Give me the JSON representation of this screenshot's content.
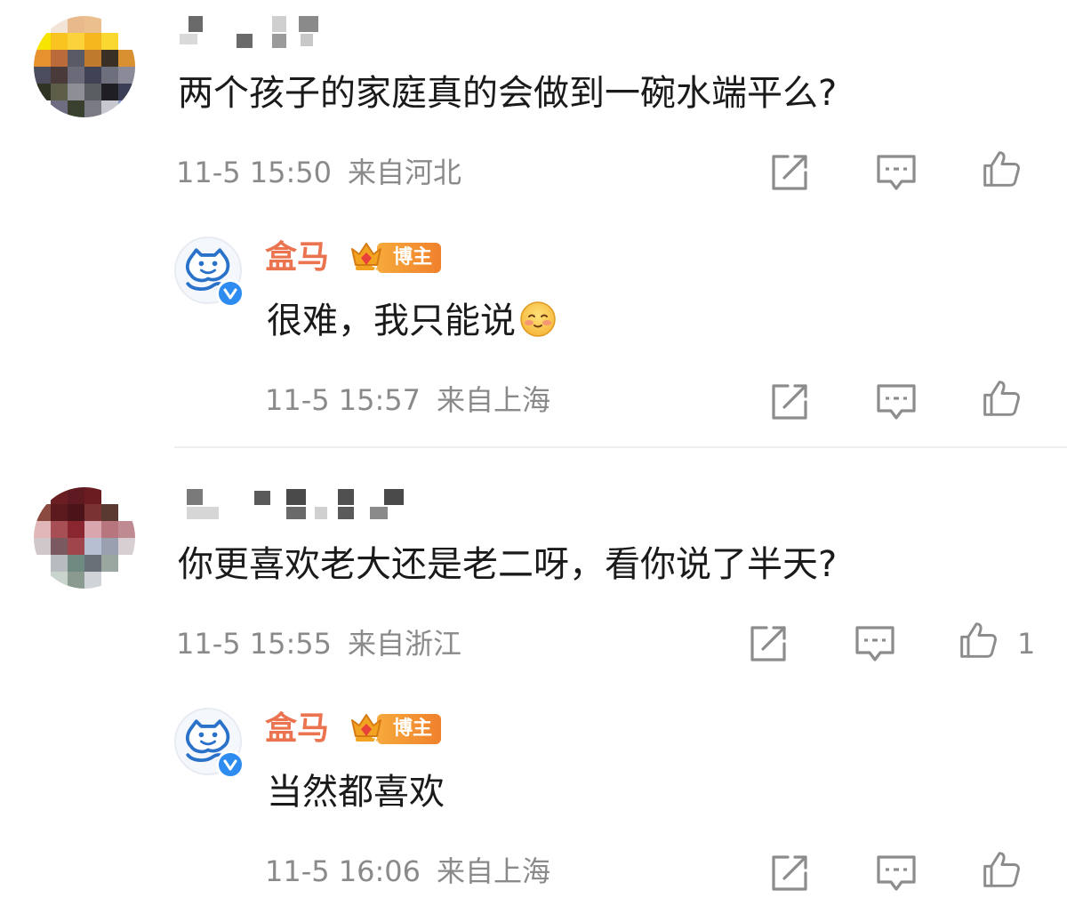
{
  "comments": [
    {
      "text": "两个孩子的家庭真的会做到一碗水端平么?",
      "time": "11-5 15:50",
      "location": "来自河北",
      "like_count": "",
      "reply": {
        "name": "盒马",
        "badge": "博主",
        "text": "很难，我只能说",
        "emoji": "blushing-smile-icon",
        "time": "11-5 15:57",
        "location": "来自上海"
      }
    },
    {
      "text": "你更喜欢老大还是老二呀，看你说了半天?",
      "time": "11-5 15:55",
      "location": "来自浙江",
      "like_count": "1",
      "reply": {
        "name": "盒马",
        "badge": "博主",
        "text": "当然都喜欢",
        "emoji": "",
        "time": "11-5 16:06",
        "location": "来自上海"
      }
    }
  ],
  "icons": {
    "repost": "repost-icon",
    "comment": "comment-icon",
    "like": "thumbs-up-icon",
    "level": "crown-icon",
    "verified": "verified-icon"
  },
  "colors": {
    "name_orange": "#eb7350",
    "meta_gray": "#8a8a8a",
    "icon_gray": "#8c8c8c",
    "verified_blue": "#2e8cf0",
    "badge_gradient_start": "#f6a93b",
    "badge_gradient_end": "#f0812c"
  }
}
